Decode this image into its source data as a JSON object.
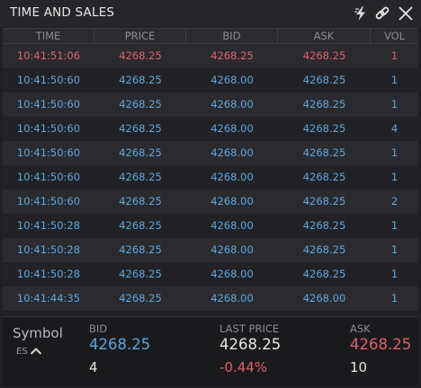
{
  "title": "TIME AND SALES",
  "columns": [
    "TIME",
    "PRICE",
    "BID",
    "ASK",
    "VOL"
  ],
  "rows": [
    {
      "side": "sell",
      "time": "10:41:51:06",
      "price": "4268.25",
      "bid": "4268.25",
      "ask": "4268.25",
      "vol": "1"
    },
    {
      "side": "buy",
      "time": "10:41:50:60",
      "price": "4268.25",
      "bid": "4268.00",
      "ask": "4268.25",
      "vol": "1"
    },
    {
      "side": "buy",
      "time": "10:41:50:60",
      "price": "4268.25",
      "bid": "4268.00",
      "ask": "4268.25",
      "vol": "1"
    },
    {
      "side": "buy",
      "time": "10:41:50:60",
      "price": "4268.25",
      "bid": "4268.00",
      "ask": "4268.25",
      "vol": "4"
    },
    {
      "side": "buy",
      "time": "10:41:50:60",
      "price": "4268.25",
      "bid": "4268.00",
      "ask": "4268.25",
      "vol": "1"
    },
    {
      "side": "buy",
      "time": "10:41:50:60",
      "price": "4268.25",
      "bid": "4268.00",
      "ask": "4268.25",
      "vol": "1"
    },
    {
      "side": "buy",
      "time": "10:41:50:60",
      "price": "4268.25",
      "bid": "4268.00",
      "ask": "4268.25",
      "vol": "2"
    },
    {
      "side": "buy",
      "time": "10:41:50:28",
      "price": "4268.25",
      "bid": "4268.00",
      "ask": "4268.25",
      "vol": "1"
    },
    {
      "side": "buy",
      "time": "10:41:50:28",
      "price": "4268.25",
      "bid": "4268.00",
      "ask": "4268.25",
      "vol": "1"
    },
    {
      "side": "buy",
      "time": "10:41:50:28",
      "price": "4268.25",
      "bid": "4268.00",
      "ask": "4268.25",
      "vol": "1"
    },
    {
      "side": "buy",
      "time": "10:41:44:35",
      "price": "4268.25",
      "bid": "4268.00",
      "ask": "4268.00",
      "vol": "1"
    }
  ],
  "footer": {
    "symbol_label": "Symbol",
    "symbol_value": "ES",
    "bid_label": "BID",
    "bid_price": "4268.25",
    "bid_size": "4",
    "last_label": "LAST PRICE",
    "last_price": "4268.25",
    "last_change": "-0.44%",
    "ask_label": "ASK",
    "ask_price": "4268.25",
    "ask_size": "10"
  },
  "colors": {
    "buy": "#5da6e0",
    "sell": "#e0606a",
    "background": "#202023"
  },
  "icons": {
    "flash": "lightning-bolt",
    "link": "chain-link",
    "close": "x-close"
  }
}
